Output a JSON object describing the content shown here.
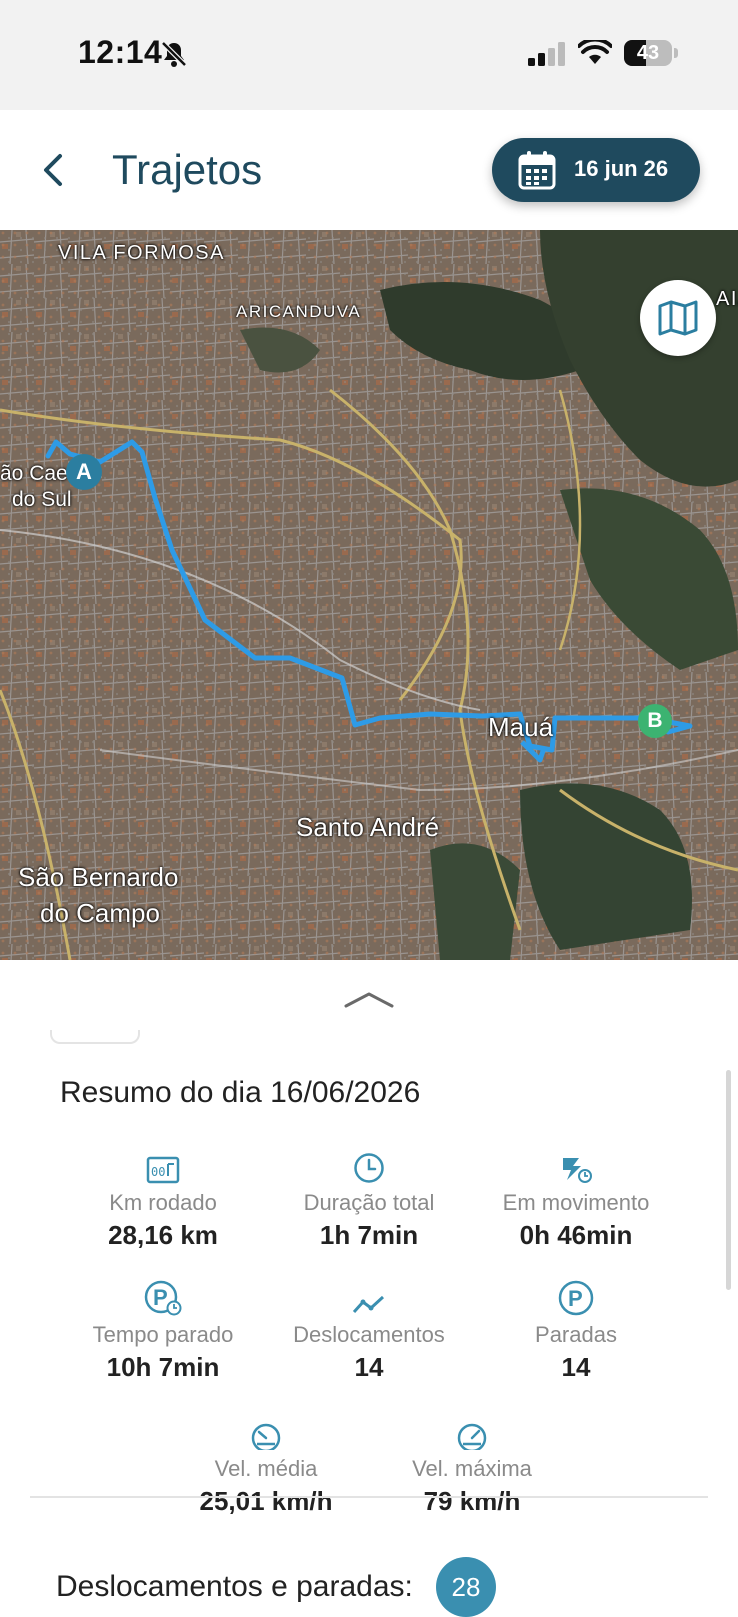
{
  "status_bar": {
    "time": "12:14",
    "battery": "43"
  },
  "header": {
    "title": "Trajetos",
    "date_button": "16 jun 26"
  },
  "map": {
    "labels": [
      "VILA FORMOSA",
      "ARICANDUVA",
      "ão Caet",
      "do Sul",
      "Mauá",
      "Santo André",
      "São Bernardo",
      "do Campo",
      "AIA"
    ],
    "markers": {
      "start": "A",
      "end": "B"
    },
    "route_color": "#2e9be6",
    "start_color": "#2b7ea0",
    "end_color": "#3cb371"
  },
  "summary": {
    "title": "Resumo do dia 16/06/2026",
    "stats": [
      {
        "icon": "odometer-icon",
        "label": "Km rodado",
        "value": "28,16 km"
      },
      {
        "icon": "clock-icon",
        "label": "Duração total",
        "value": "1h 7min"
      },
      {
        "icon": "moving-icon",
        "label": "Em movimento",
        "value": "0h 46min"
      },
      {
        "icon": "parking-clock-icon",
        "label": "Tempo parado",
        "value": "10h 7min"
      },
      {
        "icon": "trend-line-icon",
        "label": "Deslocamentos",
        "value": "14"
      },
      {
        "icon": "parking-icon",
        "label": "Paradas",
        "value": "14"
      },
      {
        "icon": "speedometer-icon",
        "label": "Vel. média",
        "value": "25,01 km/h"
      },
      {
        "icon": "speedometer-max-icon",
        "label": "Vel. máxima",
        "value": "79 km/h"
      }
    ]
  },
  "trips": {
    "label": "Deslocamentos e paradas:",
    "count": "28"
  },
  "colors": {
    "primary": "#1f4a5e",
    "accent": "#3a8fb0"
  }
}
